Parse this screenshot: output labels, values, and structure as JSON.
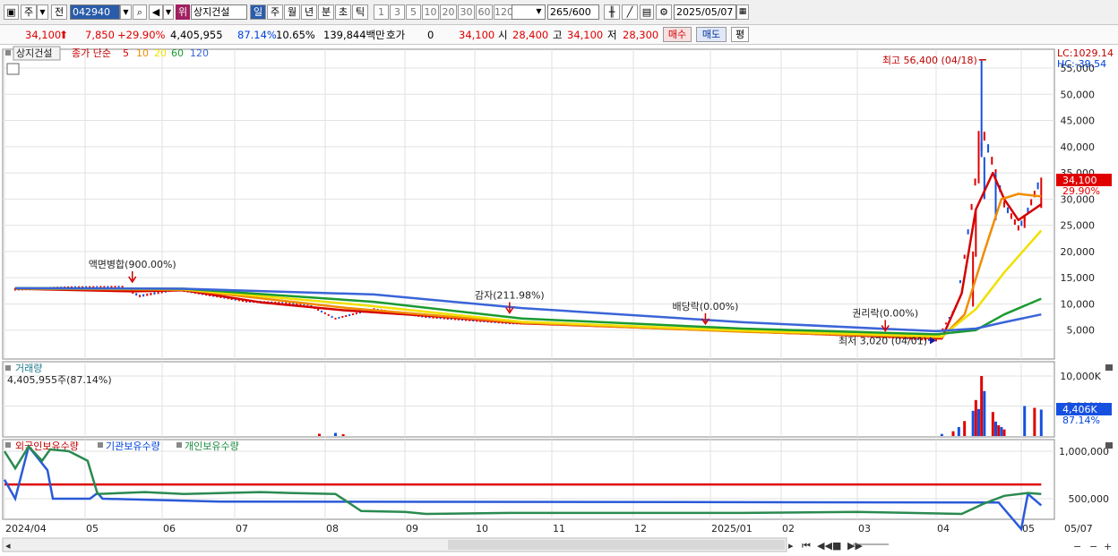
{
  "toolbar": {
    "mode_label": "주",
    "prev_label": "전",
    "stock_code": "042940",
    "stock_badge": "위",
    "stock_name": "상지건설",
    "period_tabs": [
      "일",
      "주",
      "월",
      "년",
      "분",
      "초",
      "틱"
    ],
    "interval_buttons": [
      "1",
      "3",
      "5",
      "10",
      "20",
      "30",
      "60",
      "120"
    ],
    "count_value": "265",
    "count_max": "/600",
    "date_value": "2025/05/07"
  },
  "quote": {
    "price": "34,100",
    "change": "7,850",
    "change_pct": "+29.90%",
    "volume": "4,405,955",
    "volume_ratio": "87.14%",
    "turnover": "10.65%",
    "amount": "139,844백만",
    "hoga_label": "호가",
    "hoga_value": "0",
    "hoga_price": "34,100",
    "open_label": "시",
    "open": "28,400",
    "high_label": "고",
    "high": "34,100",
    "low_label": "저",
    "low": "28,300",
    "buy_label": "매수",
    "sell_label": "매도",
    "eval_label": "평"
  },
  "colors": {
    "up": "#e00000",
    "down": "#1550e0",
    "ma5": "#d40000",
    "ma10": "#f08c00",
    "ma20": "#f0e000",
    "ma60": "#1a9a30",
    "ma120": "#3a64d8"
  },
  "chart_data": [
    {
      "type": "line",
      "title": "상지건설",
      "legend": [
        "종가 단순",
        "5",
        "10",
        "20",
        "60",
        "120"
      ],
      "x_ticks": [
        "2024/04",
        "05",
        "06",
        "07",
        "08",
        "09",
        "10",
        "11",
        "12",
        "2025/01",
        "02",
        "03",
        "04",
        "05",
        "05/07"
      ],
      "y_ticks": [
        5000,
        10000,
        15000,
        20000,
        25000,
        30000,
        35000,
        40000,
        45000,
        50000,
        55000
      ],
      "y_tick_labels": [
        "5,000",
        "10,000",
        "15,000",
        "20,000",
        "25,000",
        "30,000",
        "35,000",
        "40,000",
        "45,000",
        "50,000",
        "55,000"
      ],
      "ylim": [
        0,
        57500
      ],
      "grid": true,
      "side_labels": {
        "lc": "LC:1029.14",
        "hc": "HC:-39.54",
        "price": "34,100",
        "pct": "29.90%"
      },
      "annotations": [
        {
          "text": "액면병합(900.00%)",
          "x": "2024/05/20",
          "y": 13500
        },
        {
          "text": "감자(211.98%)",
          "x": "2024/10/15",
          "y": 7600
        },
        {
          "text": "배당락(0.00%)",
          "x": "2024/12/30",
          "y": 5500
        },
        {
          "text": "권리락(0.00%)",
          "x": "2025/03/12",
          "y": 4200
        },
        {
          "text": "최고 56,400 (04/18)",
          "x": "2025/04/18",
          "y": 56400
        },
        {
          "text": "최저 3,020 (04/01)",
          "x": "2025/04/01",
          "y": 3020
        }
      ],
      "candles": [
        {
          "date": "2024/04/05",
          "close": 12800
        },
        {
          "date": "2024/04/26",
          "close": 13100
        },
        {
          "date": "2024/05/16",
          "close": 13200
        },
        {
          "date": "2024/05/23",
          "close": 11500
        },
        {
          "date": "2024/06/07",
          "close": 12800
        },
        {
          "date": "2024/07/05",
          "close": 10500
        },
        {
          "date": "2024/07/26",
          "close": 9900
        },
        {
          "date": "2024/08/05",
          "close": 7200
        },
        {
          "date": "2024/08/20",
          "close": 9000
        },
        {
          "date": "2024/09/10",
          "close": 7500
        },
        {
          "date": "2024/10/15",
          "close": 6300
        },
        {
          "date": "2024/11/15",
          "close": 6000
        },
        {
          "date": "2024/12/10",
          "close": 5400
        },
        {
          "date": "2025/01/15",
          "close": 4700
        },
        {
          "date": "2025/02/15",
          "close": 4200
        },
        {
          "date": "2025/03/15",
          "close": 3600
        },
        {
          "date": "2025/04/01",
          "close": 3020
        },
        {
          "date": "2025/04/08",
          "close": 9500
        },
        {
          "date": "2025/04/11",
          "close": 19000
        },
        {
          "date": "2025/04/16",
          "close": 38000
        },
        {
          "date": "2025/04/18",
          "close": 42000
        },
        {
          "date": "2025/04/22",
          "close": 35000
        },
        {
          "date": "2025/04/25",
          "close": 29000
        },
        {
          "date": "2025/04/30",
          "close": 24500
        },
        {
          "date": "2025/05/02",
          "close": 26250
        },
        {
          "date": "2025/05/07",
          "close": 34100
        }
      ],
      "series": [
        {
          "name": "5",
          "points": [
            [
              "2024/04/05",
              12900
            ],
            [
              "2024/05/20",
              12400
            ],
            [
              "2024/06/10",
              12600
            ],
            [
              "2024/07/10",
              10300
            ],
            [
              "2024/08/08",
              8800
            ],
            [
              "2024/09/15",
              7600
            ],
            [
              "2024/10/20",
              6300
            ],
            [
              "2024/12/15",
              5300
            ],
            [
              "2025/03/15",
              3700
            ],
            [
              "2025/04/03",
              3400
            ],
            [
              "2025/04/10",
              12000
            ],
            [
              "2025/04/15",
              28000
            ],
            [
              "2025/04/21",
              35000
            ],
            [
              "2025/04/25",
              30000
            ],
            [
              "2025/04/30",
              26000
            ],
            [
              "2025/05/07",
              29000
            ]
          ]
        },
        {
          "name": "10",
          "points": [
            [
              "2024/04/05",
              12900
            ],
            [
              "2024/06/10",
              12700
            ],
            [
              "2024/08/10",
              9200
            ],
            [
              "2024/10/20",
              6400
            ],
            [
              "2025/01/15",
              4700
            ],
            [
              "2025/04/03",
              3600
            ],
            [
              "2025/04/11",
              8000
            ],
            [
              "2025/04/18",
              20000
            ],
            [
              "2025/04/24",
              30000
            ],
            [
              "2025/04/30",
              31000
            ],
            [
              "2025/05/07",
              30500
            ]
          ]
        },
        {
          "name": "20",
          "points": [
            [
              "2024/04/05",
              13000
            ],
            [
              "2024/06/10",
              12800
            ],
            [
              "2024/08/15",
              9800
            ],
            [
              "2024/10/20",
              6600
            ],
            [
              "2025/01/15",
              4900
            ],
            [
              "2025/04/03",
              3800
            ],
            [
              "2025/04/15",
              9000
            ],
            [
              "2025/04/25",
              16000
            ],
            [
              "2025/05/07",
              24000
            ]
          ]
        },
        {
          "name": "60",
          "points": [
            [
              "2024/04/05",
              13000
            ],
            [
              "2024/06/10",
              12900
            ],
            [
              "2024/08/20",
              10400
            ],
            [
              "2024/10/20",
              7200
            ],
            [
              "2025/01/15",
              5300
            ],
            [
              "2025/04/01",
              4200
            ],
            [
              "2025/04/15",
              5000
            ],
            [
              "2025/04/25",
              8000
            ],
            [
              "2025/05/07",
              11000
            ]
          ]
        },
        {
          "name": "120",
          "points": [
            [
              "2024/04/05",
              13000
            ],
            [
              "2024/06/10",
              12900
            ],
            [
              "2024/08/20",
              11800
            ],
            [
              "2024/10/20",
              9200
            ],
            [
              "2025/01/15",
              6500
            ],
            [
              "2025/04/01",
              4800
            ],
            [
              "2025/04/15",
              5300
            ],
            [
              "2025/04/25",
              6500
            ],
            [
              "2025/05/07",
              8000
            ]
          ]
        }
      ]
    },
    {
      "type": "bar",
      "title": "거래량",
      "subtitle": "4,405,955주(87.14%)",
      "y_ticks": [
        5000,
        10000
      ],
      "y_tick_labels": [
        "5,000K",
        "10,000K"
      ],
      "ylim": [
        0,
        11800
      ],
      "side_labels": {
        "value": "4,406K",
        "pct": "87.14%"
      },
      "bars": [
        {
          "date": "2024/07/30",
          "value": 380
        },
        {
          "date": "2024/08/05",
          "value": 520
        },
        {
          "date": "2024/08/08",
          "value": 300
        },
        {
          "date": "2025/04/03",
          "value": 350
        },
        {
          "date": "2025/04/07",
          "value": 800
        },
        {
          "date": "2025/04/09",
          "value": 1500
        },
        {
          "date": "2025/04/11",
          "value": 2500
        },
        {
          "date": "2025/04/14",
          "value": 4200
        },
        {
          "date": "2025/04/15",
          "value": 6000
        },
        {
          "date": "2025/04/16",
          "value": 4500
        },
        {
          "date": "2025/04/17",
          "value": 10000
        },
        {
          "date": "2025/04/18",
          "value": 7500
        },
        {
          "date": "2025/04/21",
          "value": 4000
        },
        {
          "date": "2025/04/22",
          "value": 2400
        },
        {
          "date": "2025/04/23",
          "value": 1800
        },
        {
          "date": "2025/04/24",
          "value": 1500
        },
        {
          "date": "2025/04/25",
          "value": 1100
        },
        {
          "date": "2025/05/02",
          "value": 5000
        },
        {
          "date": "2025/05/05",
          "value": 4700
        },
        {
          "date": "2025/05/07",
          "value": 4406
        }
      ]
    },
    {
      "type": "line",
      "title": "보유수량",
      "legend": [
        "외국인보유수량",
        "기관보유수량",
        "개인보유수량"
      ],
      "y_ticks": [
        500000,
        1000000
      ],
      "y_tick_labels": [
        "500,000",
        "1,000,000"
      ],
      "ylim": [
        110000,
        1130000
      ],
      "series": [
        {
          "name": "외국인보유수량",
          "points": [
            [
              "2024/04/01",
              650000
            ],
            [
              "2025/05/07",
              650000
            ]
          ]
        },
        {
          "name": "기관보유수량",
          "points": [
            [
              "2024/04/01",
              700000
            ],
            [
              "2024/04/05",
              500000
            ],
            [
              "2024/04/10",
              1050000
            ],
            [
              "2024/04/17",
              800000
            ],
            [
              "2024/04/19",
              500000
            ],
            [
              "2024/05/03",
              500000
            ],
            [
              "2024/05/06",
              560000
            ],
            [
              "2024/05/08",
              500000
            ],
            [
              "2024/06/25",
              470000
            ],
            [
              "2025/04/23",
              460000
            ],
            [
              "2025/05/01",
              180000
            ],
            [
              "2025/05/03",
              550000
            ],
            [
              "2025/05/07",
              430000
            ]
          ]
        },
        {
          "name": "개인보유수량",
          "points": [
            [
              "2024/04/01",
              1000000
            ],
            [
              "2024/04/05",
              820000
            ],
            [
              "2024/04/10",
              1050000
            ],
            [
              "2024/04/15",
              900000
            ],
            [
              "2024/04/18",
              1020000
            ],
            [
              "2024/04/25",
              1000000
            ],
            [
              "2024/05/02",
              900000
            ],
            [
              "2024/05/06",
              550000
            ],
            [
              "2024/05/25",
              570000
            ],
            [
              "2024/06/10",
              550000
            ],
            [
              "2024/07/10",
              570000
            ],
            [
              "2024/07/20",
              560000
            ],
            [
              "2024/08/05",
              550000
            ],
            [
              "2024/08/15",
              370000
            ],
            [
              "2024/09/01",
              360000
            ],
            [
              "2024/09/10",
              340000
            ],
            [
              "2024/10/15",
              350000
            ],
            [
              "2025/01/15",
              350000
            ],
            [
              "2025/03/01",
              360000
            ],
            [
              "2025/04/10",
              340000
            ],
            [
              "2025/04/18",
              450000
            ],
            [
              "2025/04/25",
              530000
            ],
            [
              "2025/05/03",
              560000
            ],
            [
              "2025/05/07",
              550000
            ]
          ]
        }
      ]
    }
  ]
}
